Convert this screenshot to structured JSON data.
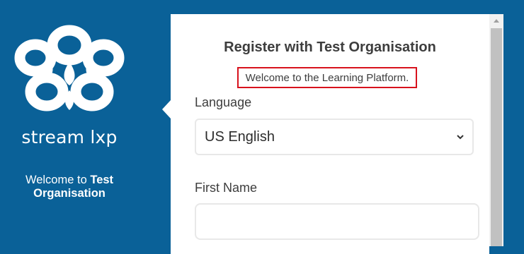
{
  "sidebar": {
    "logo_icon": "flower-logo-icon",
    "brand": "stream lxp",
    "welcome_prefix": "Welcome to ",
    "welcome_org": "Test Organisation"
  },
  "form": {
    "title": "Register with Test Organisation",
    "welcome_message": "Welcome to the Learning Platform.",
    "language_label": "Language",
    "language_value": "US English",
    "first_name_label": "First Name",
    "first_name_value": ""
  },
  "colors": {
    "background": "#0a6198",
    "highlight_border": "#d8121d"
  }
}
